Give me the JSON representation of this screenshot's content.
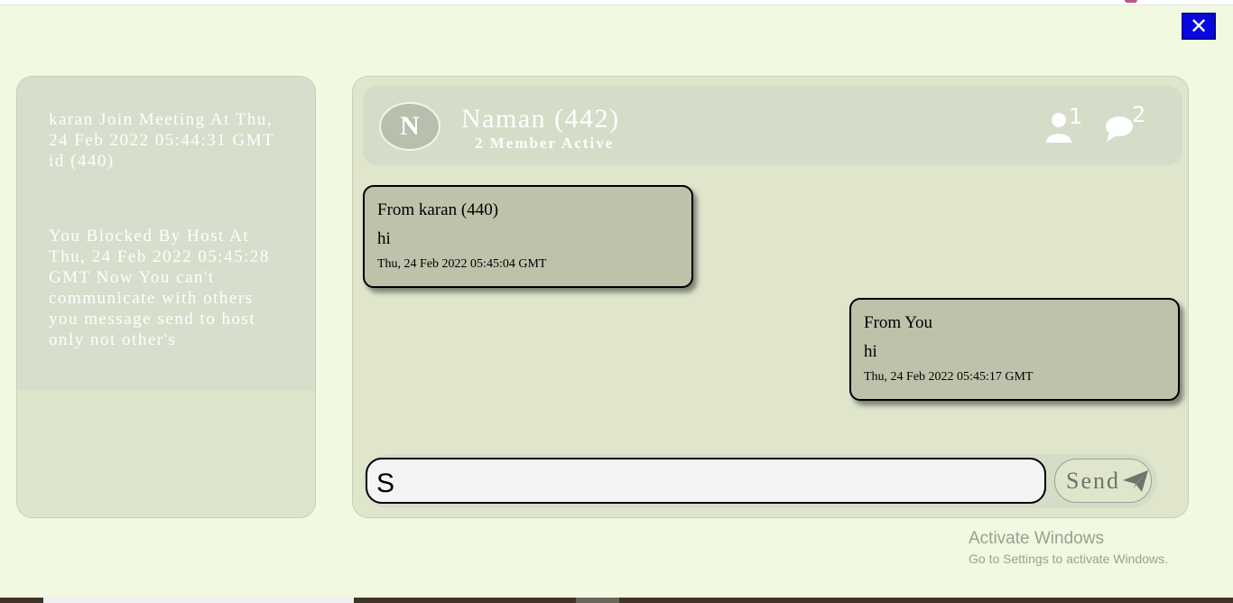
{
  "notifications": [
    {
      "text": "karan Join Meeting At Thu, 24 Feb 2022 05:44:31 GMT id (440)"
    },
    {
      "text": "You Blocked By Host At Thu, 24 Feb 2022 05:45:28 GMT Now You can't communicate with others you message send to host only not other's"
    }
  ],
  "chat": {
    "avatar_letter": "N",
    "group_name": "Naman (442)",
    "members_active": "2 Member Active",
    "members_count": "1",
    "chats_count": "2",
    "members_icon": "user-icon",
    "chats_icon": "chat-bubble-icon"
  },
  "messages": [
    {
      "from": "From karan (440)",
      "text": "hi",
      "time": "Thu, 24 Feb 2022 05:45:04 GMT",
      "direction": "incoming"
    },
    {
      "from": "From You",
      "text": "hi",
      "time": "Thu, 24 Feb 2022 05:45:17 GMT",
      "direction": "outgoing"
    }
  ],
  "composer": {
    "value": "S",
    "send_label": "Send",
    "send_icon": "paper-plane-icon"
  },
  "close_icon": "close-icon",
  "watermark": {
    "line1": "Activate Windows",
    "line2": "Go to Settings to activate Windows."
  },
  "colors": {
    "page_bg": "#f1f9e0",
    "panel_bg": "#dfe6cc",
    "bubble_bg": "#bec2ab",
    "close_bg": "#0a08e0"
  }
}
